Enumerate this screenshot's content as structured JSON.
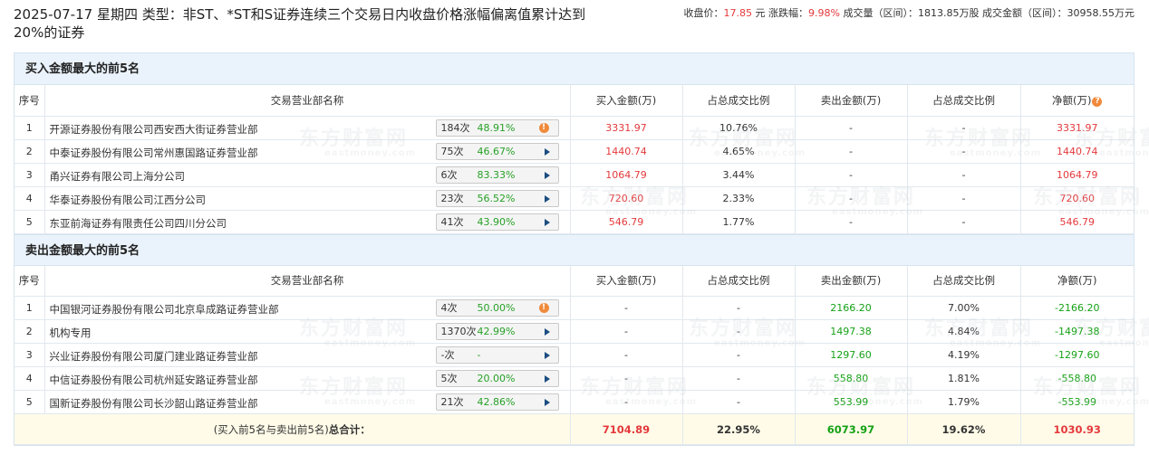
{
  "header": {
    "title": "2025-07-17 星期四 类型：非ST、*ST和S证券连续三个交易日内收盘价格涨幅偏离值累计达到20%的证券",
    "close_label": "收盘价：",
    "close_value": "17.85",
    "close_unit": "元",
    "change_label": "涨跌幅：",
    "change_value": "9.98%",
    "volume_label": "成交量（区间）：",
    "volume_value": "1813.85万股",
    "turnover_label": "成交金额（区间）：",
    "turnover_value": "30958.55万元"
  },
  "columns": {
    "seq": "序号",
    "name": "交易营业部名称",
    "buy": "买入金额(万)",
    "buy_pct": "占总成交比例",
    "sell": "卖出金额(万)",
    "sell_pct": "占总成交比例",
    "net": "净额(万)",
    "help_icon": "?"
  },
  "buy_section": {
    "title": "买入金额最大的前5名",
    "rows": [
      {
        "seq": "1",
        "name": "开源证券股份有限公司西安西大街证券营业部",
        "count": "184次",
        "rate": "48.91%",
        "icon": "warning-icon",
        "buy": "3331.97",
        "buy_pct": "10.76%",
        "sell": "-",
        "sell_pct": "-",
        "net": "3331.97"
      },
      {
        "seq": "2",
        "name": "中泰证券股份有限公司常州惠国路证券营业部",
        "count": "75次",
        "rate": "46.67%",
        "icon": "arrow-icon",
        "buy": "1440.74",
        "buy_pct": "4.65%",
        "sell": "-",
        "sell_pct": "-",
        "net": "1440.74"
      },
      {
        "seq": "3",
        "name": "甬兴证券有限公司上海分公司",
        "count": "6次",
        "rate": "83.33%",
        "icon": "arrow-icon",
        "buy": "1064.79",
        "buy_pct": "3.44%",
        "sell": "-",
        "sell_pct": "-",
        "net": "1064.79"
      },
      {
        "seq": "4",
        "name": "华泰证券股份有限公司江西分公司",
        "count": "23次",
        "rate": "56.52%",
        "icon": "arrow-icon",
        "buy": "720.60",
        "buy_pct": "2.33%",
        "sell": "-",
        "sell_pct": "-",
        "net": "720.60"
      },
      {
        "seq": "5",
        "name": "东亚前海证券有限责任公司四川分公司",
        "count": "41次",
        "rate": "43.90%",
        "icon": "arrow-icon",
        "buy": "546.79",
        "buy_pct": "1.77%",
        "sell": "-",
        "sell_pct": "-",
        "net": "546.79"
      }
    ]
  },
  "sell_section": {
    "title": "卖出金额最大的前5名",
    "rows": [
      {
        "seq": "1",
        "name": "中国银河证券股份有限公司北京阜成路证券营业部",
        "count": "4次",
        "rate": "50.00%",
        "icon": "warning-icon",
        "buy": "-",
        "buy_pct": "-",
        "sell": "2166.20",
        "sell_pct": "7.00%",
        "net": "-2166.20"
      },
      {
        "seq": "2",
        "name": "机构专用",
        "count": "1370次",
        "rate": "42.99%",
        "icon": "arrow-icon",
        "buy": "-",
        "buy_pct": "-",
        "sell": "1497.38",
        "sell_pct": "4.84%",
        "net": "-1497.38"
      },
      {
        "seq": "3",
        "name": "兴业证券股份有限公司厦门建业路证券营业部",
        "count": "-次",
        "rate": "-",
        "icon": "arrow-icon",
        "buy": "-",
        "buy_pct": "-",
        "sell": "1297.60",
        "sell_pct": "4.19%",
        "net": "-1297.60"
      },
      {
        "seq": "4",
        "name": "中信证券股份有限公司杭州延安路证券营业部",
        "count": "5次",
        "rate": "20.00%",
        "icon": "arrow-icon",
        "buy": "-",
        "buy_pct": "-",
        "sell": "558.80",
        "sell_pct": "1.81%",
        "net": "-558.80"
      },
      {
        "seq": "5",
        "name": "国新证券股份有限公司长沙韶山路证券营业部",
        "count": "21次",
        "rate": "42.86%",
        "icon": "arrow-icon",
        "buy": "-",
        "buy_pct": "-",
        "sell": "553.99",
        "sell_pct": "1.79%",
        "net": "-553.99"
      }
    ]
  },
  "total": {
    "label_prefix": "(买入前5名与卖出前5名)",
    "label_strong": "总合计：",
    "buy": "7104.89",
    "buy_pct": "22.95%",
    "sell": "6073.97",
    "sell_pct": "19.62%",
    "net": "1030.93"
  },
  "watermark": {
    "cn": "东方财富网",
    "en": "eastmoney.com"
  },
  "colors": {
    "up": "#e4393c",
    "down": "#16a216",
    "header_bg": "#eaf3fb",
    "total_bg": "#fffbe8",
    "warning": "#f08a3b",
    "arrow": "#1b4d80"
  }
}
